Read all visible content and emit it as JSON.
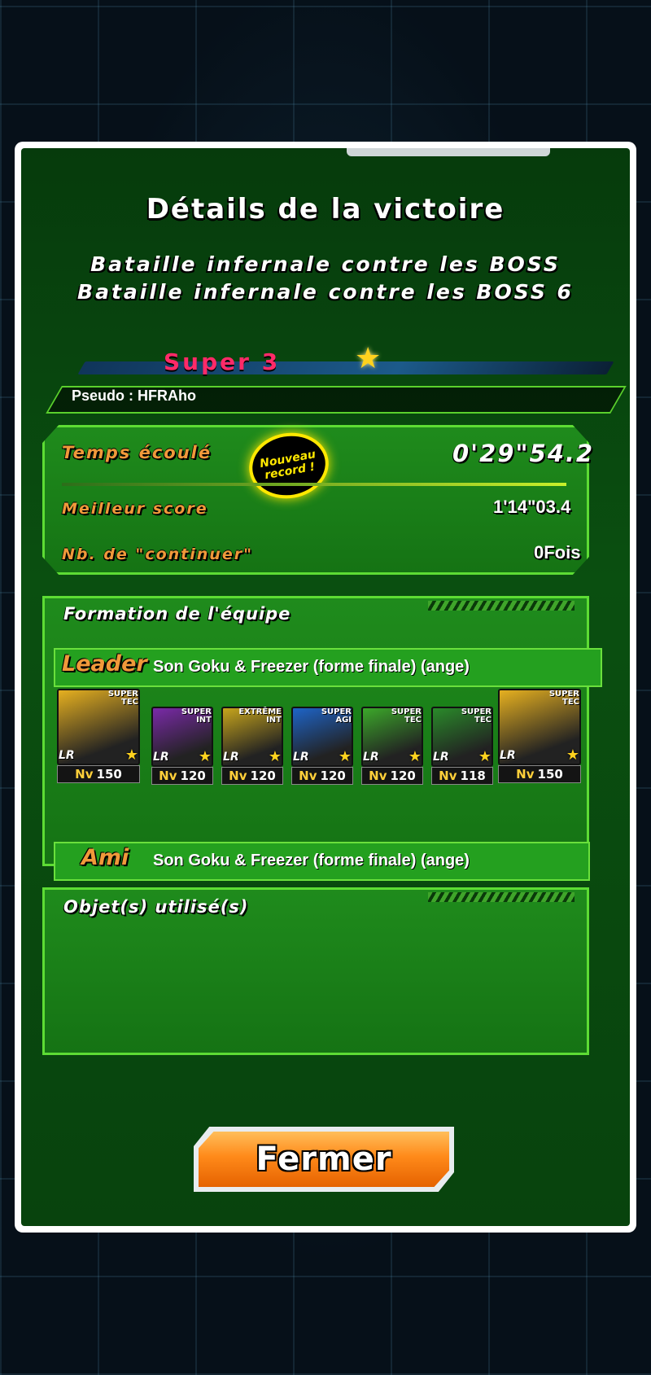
{
  "modal": {
    "title": "Détails de la victoire",
    "event_line1": "Bataille infernale contre les BOSS",
    "event_line2": "Bataille infernale contre les BOSS 6"
  },
  "rank": {
    "label": "Super 3",
    "star_icon": "star-icon"
  },
  "player": {
    "pseudo_text": "Pseudo : HFRAho"
  },
  "stats": {
    "time_label": "Temps écoulé",
    "time_value": "0'29\"54.2",
    "record_badge": "Nouveau record !",
    "best_label": "Meilleur score",
    "best_value": "1'14\"03.4",
    "continue_label": "Nb. de \"continuer\"",
    "continue_value": "0Fois"
  },
  "team": {
    "heading": "Formation de l'équipe",
    "leader_tag": "Leader",
    "leader_name": "Son Goku & Freezer (forme finale) (ange)",
    "friend_tag": "Ami",
    "friend_name": "Son Goku & Freezer (forme finale) (ange)",
    "level_prefix": "Nv",
    "cards": [
      {
        "role": "leader",
        "level": "150",
        "type": "SUPER\nTEC",
        "rarity": "LR",
        "color": "#e6b020"
      },
      {
        "role": "member",
        "level": "120",
        "type": "SUPER\nINT",
        "rarity": "LR",
        "color": "#7a2aa8"
      },
      {
        "role": "member",
        "level": "120",
        "type": "EXTRÊME\nINT",
        "rarity": "LR",
        "color": "#c7a51c"
      },
      {
        "role": "member",
        "level": "120",
        "type": "SUPER\nAGI",
        "rarity": "LR",
        "color": "#1e64c8"
      },
      {
        "role": "member",
        "level": "120",
        "type": "SUPER\nTEC",
        "rarity": "LR",
        "color": "#3ca82a"
      },
      {
        "role": "member",
        "level": "118",
        "type": "SUPER\nTEC",
        "rarity": "LR",
        "color": "#2a8a2a"
      },
      {
        "role": "friend",
        "level": "150",
        "type": "SUPER\nTEC",
        "rarity": "LR",
        "color": "#e6b020"
      }
    ]
  },
  "items": {
    "heading": "Objet(s) utilisé(s)"
  },
  "buttons": {
    "close_label": "Fermer"
  }
}
